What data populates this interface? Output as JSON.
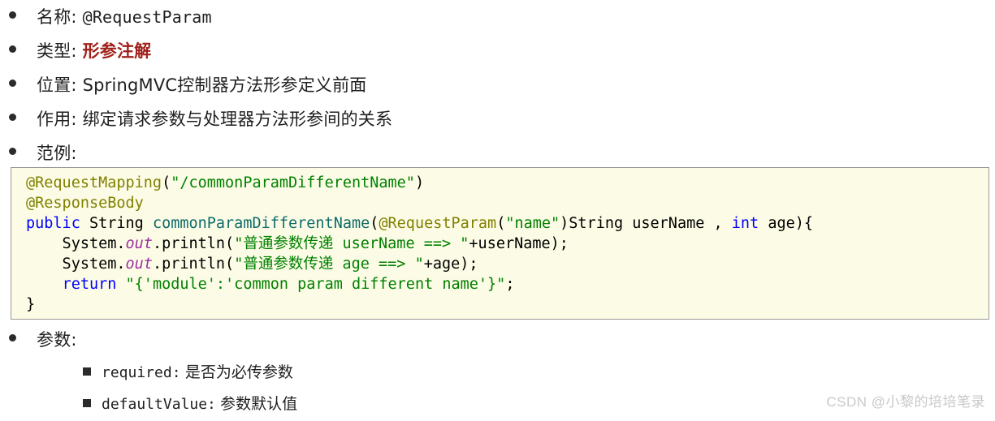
{
  "outline": {
    "items": [
      {
        "label": "名称:",
        "value": "@RequestParam",
        "emphasis": false,
        "mono": true
      },
      {
        "label": "类型:",
        "value": "形参注解",
        "emphasis": true,
        "mono": false
      },
      {
        "label": "位置:",
        "value": "SpringMVC控制器方法形参定义前面",
        "emphasis": false,
        "mono": false
      },
      {
        "label": "作用:",
        "value": "绑定请求参数与处理器方法形参间的关系",
        "emphasis": false,
        "mono": false
      },
      {
        "label": "范例:",
        "value": "",
        "emphasis": false,
        "mono": false
      },
      {
        "label": "参数:",
        "value": "",
        "emphasis": false,
        "mono": false
      }
    ],
    "sub_items": [
      {
        "name": "required:",
        "desc": "是否为必传参数"
      },
      {
        "name": "defaultValue:",
        "desc": "参数默认值"
      }
    ]
  },
  "code_block": {
    "language": "java",
    "lines": [
      [
        {
          "t": "@RequestMapping",
          "c": "ann"
        },
        {
          "t": "(",
          "c": "plain"
        },
        {
          "t": "\"/commonParamDifferentName\"",
          "c": "str"
        },
        {
          "t": ")",
          "c": "plain"
        }
      ],
      [
        {
          "t": "@ResponseBody",
          "c": "ann"
        }
      ],
      [
        {
          "t": "public",
          "c": "kw"
        },
        {
          "t": " String ",
          "c": "plain"
        },
        {
          "t": "commonParamDifferentName",
          "c": "method"
        },
        {
          "t": "(",
          "c": "plain"
        },
        {
          "t": "@RequestParam",
          "c": "ann"
        },
        {
          "t": "(",
          "c": "plain"
        },
        {
          "t": "\"name\"",
          "c": "str"
        },
        {
          "t": ")String userName , ",
          "c": "plain"
        },
        {
          "t": "int",
          "c": "kw"
        },
        {
          "t": " age){",
          "c": "plain"
        }
      ],
      [
        {
          "t": "    System.",
          "c": "plain"
        },
        {
          "t": "out",
          "c": "field"
        },
        {
          "t": ".println(",
          "c": "plain"
        },
        {
          "t": "\"普通参数传递 userName ==> \"",
          "c": "str"
        },
        {
          "t": "+userName);",
          "c": "plain"
        }
      ],
      [
        {
          "t": "    System.",
          "c": "plain"
        },
        {
          "t": "out",
          "c": "field"
        },
        {
          "t": ".println(",
          "c": "plain"
        },
        {
          "t": "\"普通参数传递 age ==> \"",
          "c": "str"
        },
        {
          "t": "+age);",
          "c": "plain"
        }
      ],
      [
        {
          "t": "    ",
          "c": "plain"
        },
        {
          "t": "return",
          "c": "kw"
        },
        {
          "t": " ",
          "c": "plain"
        },
        {
          "t": "\"{'module':'common param different name'}\"",
          "c": "str"
        },
        {
          "t": ";",
          "c": "plain"
        }
      ],
      [
        {
          "t": "}",
          "c": "plain"
        }
      ]
    ]
  },
  "watermark": {
    "text": "CSDN @小黎的培培笔录"
  },
  "colors": {
    "code_background": "#fcfce6",
    "code_border": "#9a9a9a",
    "emphasis_red": "#a0211b",
    "annotation": "#808000",
    "string": "#008000",
    "keyword": "#0000ff",
    "method": "#0d6b6b",
    "field": "#9b30a0",
    "watermark": "#c9c9c9"
  }
}
